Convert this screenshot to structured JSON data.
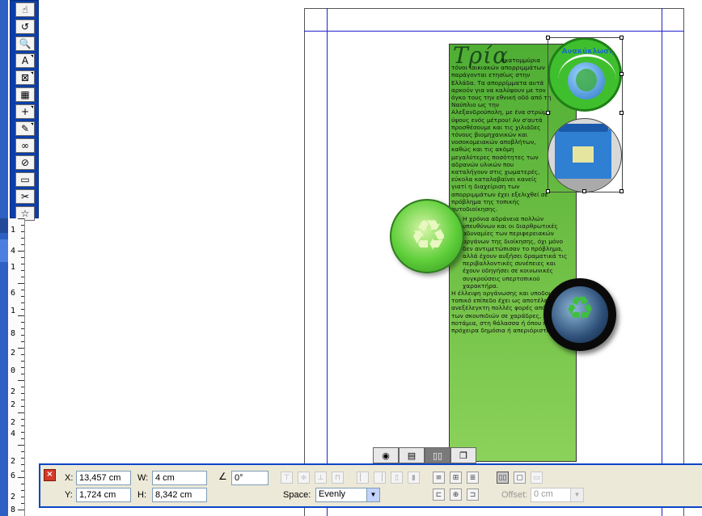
{
  "toolbox": {
    "tools": [
      {
        "icon": "hand-pointer-icon",
        "glyph": "☝"
      },
      {
        "icon": "rotate-icon",
        "glyph": "↺"
      },
      {
        "icon": "zoom-icon",
        "glyph": "🔍"
      },
      {
        "icon": "text-tool-icon",
        "glyph": "A"
      },
      {
        "icon": "picture-box-icon",
        "glyph": "⊠"
      },
      {
        "icon": "table-tool-icon",
        "glyph": "▦"
      },
      {
        "icon": "line-tool-icon",
        "glyph": "+"
      },
      {
        "icon": "pen-tool-icon",
        "glyph": "✎"
      },
      {
        "icon": "link-icon",
        "glyph": "∞"
      },
      {
        "icon": "unlink-icon",
        "glyph": "⊘"
      },
      {
        "icon": "layer-icon",
        "glyph": "▭"
      },
      {
        "icon": "scissors-icon",
        "glyph": "✂"
      },
      {
        "icon": "star-icon",
        "glyph": "☆"
      }
    ]
  },
  "ruler": {
    "labels": [
      "1",
      "4",
      "1",
      "6",
      "1",
      "8",
      "2",
      "0",
      "2",
      "2",
      "2",
      "4",
      "2",
      "6",
      "2",
      "8"
    ]
  },
  "document": {
    "title": "Τρία",
    "text_lead": "εκατομμύρια",
    "text_body": "τόνοι ιαικιακών απορριμμάτων παράγονται ετησίως στην Ελλάδα. Τα απορρίμματα αυτά αρκούν για να καλύψουν με τον όγκο τους την εθνική οδό από τη Ναύπλιο ως την Αλεξανδρούπολη, με ένα στρώμα ύψους ενός μέτρου! Αν σ'αυτά προσθέσουμε και τις χιλιάδες τόνους βιομηχανικών και νοσοκομειακών αποβλήτων, καθώς και τις ακόμη μεγαλύτερες ποσότητες των αδρανών υλικών που καταλήγουν στις χωματερές, εύκολα καταλαβαίνει κανείς γιατί η διαχείριση των απορριμμάτων έχει εξελιχθεί σε πρόβλημα της τοπικής αυτοδιοίκησης.",
    "para2": "Η χρόνια αδράνεια πολλών υπευθύνων και οι διαρθρωτικές αδυναμίες των περιφερειακών οργάνων της διοίκησης, όχι μόνο δεν αντιμετώπισαν το πρόβλημα, αλλά έχουν αυξήσει δραματικά τις περιβαλλοντικές συνέπειες και έχουν οδηγήσει σε κοινωνικές συγκρούσεις υπερτοπικού χαρακτήρα.",
    "para3": "Η έλλειψη οργάνωσης και υποδομής στο τοπικό επίπεδο έχει ως αποτέλεσμα την ανεξέλεγκτη πολλές φορές απόρριψη των σκουπιδιών σε χαράδρες, σε ποτάμια, στη θάλασσα ή όπου πιο πρόχειρα δημόσια ή απεριόριστα χώρα.",
    "badge_caption": "Ανακύκλωση"
  },
  "view_buttons": [
    {
      "icon": "color-wheel-icon",
      "glyph": "◉"
    },
    {
      "icon": "film-icon",
      "glyph": "▤"
    },
    {
      "icon": "align-objects-icon",
      "glyph": "▯▯"
    },
    {
      "icon": "duplicate-icon",
      "glyph": "❐"
    }
  ],
  "palette": {
    "x_label": "X:",
    "x_value": "13,457 cm",
    "y_label": "Y:",
    "y_value": "1,724 cm",
    "w_label": "W:",
    "w_value": "4 cm",
    "h_label": "H:",
    "h_value": "8,342 cm",
    "angle_value": "0°",
    "space_label": "Space:",
    "space_value": "Evenly",
    "offset_label": "Offset:",
    "offset_value": "0 cm"
  },
  "colors": {
    "toolbox_blue": "#0b3ea8",
    "frame_green": "#6fbf45",
    "guide_blue": "#2222cc"
  }
}
